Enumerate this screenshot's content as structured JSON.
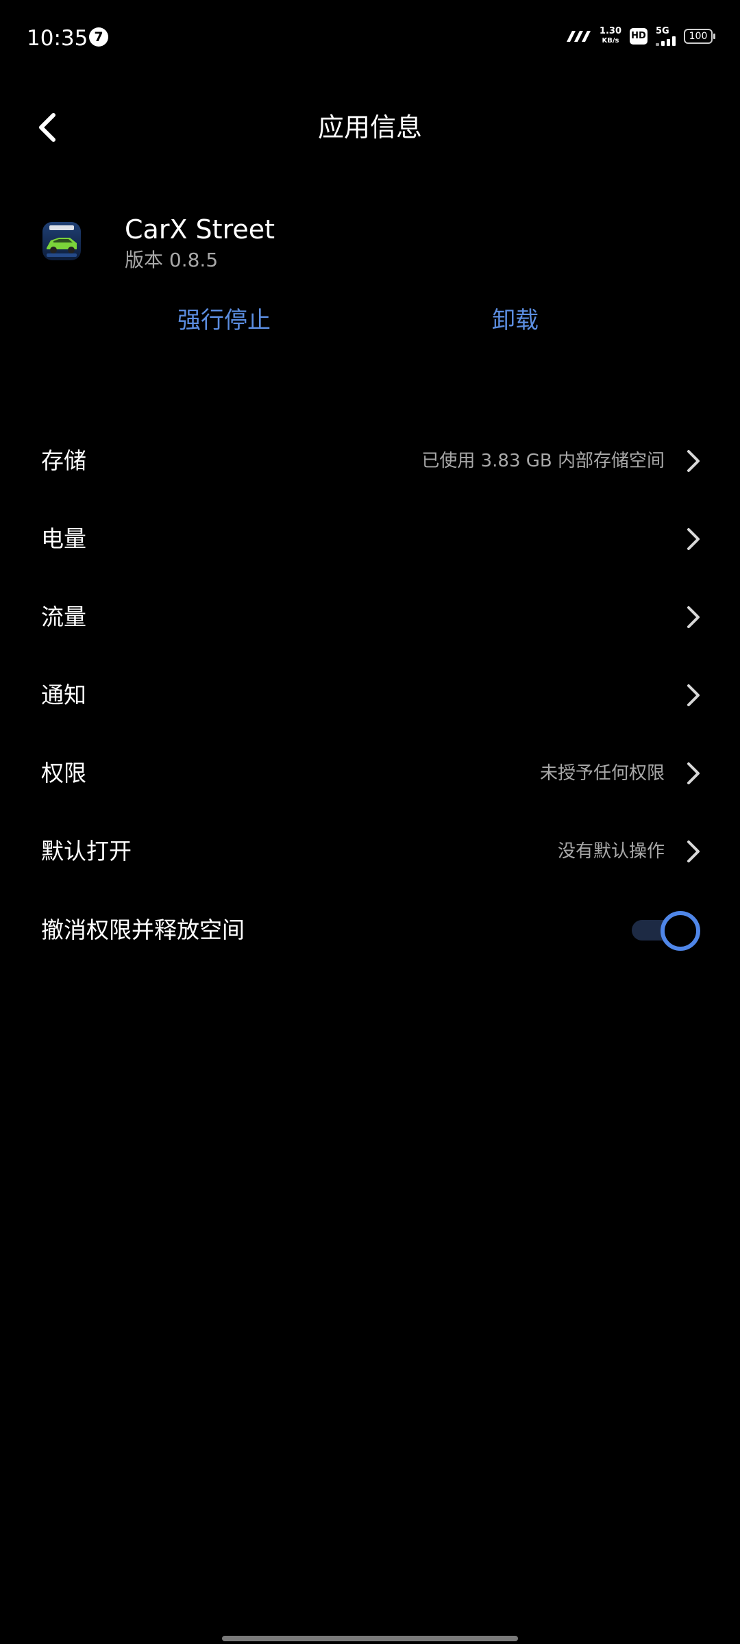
{
  "status_bar": {
    "time": "10:35",
    "notification_count": "7",
    "net_speed_value": "1.30",
    "net_speed_unit": "KB/s",
    "hd_label": "HD",
    "network_label": "5G",
    "battery_level": "100"
  },
  "header": {
    "title": "应用信息"
  },
  "app": {
    "name": "CarX Street",
    "version": "版本 0.8.5",
    "icon": "carx-street-app-icon"
  },
  "actions": {
    "force_stop": "强行停止",
    "uninstall": "卸载"
  },
  "settings": {
    "items": [
      {
        "label": "存储",
        "value": "已使用 3.83 GB 内部存储空间"
      },
      {
        "label": "电量",
        "value": ""
      },
      {
        "label": "流量",
        "value": ""
      },
      {
        "label": "通知",
        "value": ""
      },
      {
        "label": "权限",
        "value": "未授予任何权限"
      },
      {
        "label": "默认打开",
        "value": "没有默认操作"
      }
    ],
    "toggle": {
      "label": "撤消权限并释放空间",
      "on": true
    }
  },
  "colors": {
    "accent": "#5b8de0",
    "background": "#000000",
    "secondary_text": "#a8a8a8"
  }
}
